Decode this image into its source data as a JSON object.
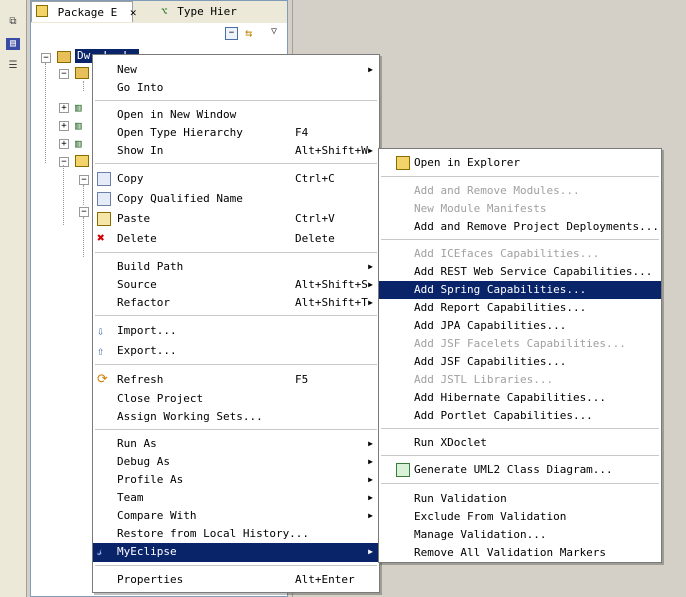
{
  "tabs": [
    {
      "label": "Package E"
    },
    {
      "label": "Type Hier"
    }
  ],
  "tree": {
    "project_label": "Dw. L. L."
  },
  "context_menu": {
    "items": [
      {
        "label": "New",
        "accel": "",
        "submenu": true
      },
      {
        "label": "Go Into",
        "accel": "",
        "submenu": false
      },
      {
        "label": "Open in New Window",
        "accel": "",
        "submenu": false
      },
      {
        "label": "Open Type Hierarchy",
        "accel": "F4",
        "submenu": false
      },
      {
        "label": "Show In",
        "accel": "Alt+Shift+W",
        "submenu": true
      },
      {
        "label": "Copy",
        "accel": "Ctrl+C",
        "submenu": false,
        "icon": "copy-icon"
      },
      {
        "label": "Copy Qualified Name",
        "accel": "",
        "submenu": false,
        "icon": "copy-qualified-icon"
      },
      {
        "label": "Paste",
        "accel": "Ctrl+V",
        "submenu": false,
        "icon": "paste-icon"
      },
      {
        "label": "Delete",
        "accel": "Delete",
        "submenu": false,
        "icon": "delete-icon"
      },
      {
        "label": "Build Path",
        "accel": "",
        "submenu": true
      },
      {
        "label": "Source",
        "accel": "Alt+Shift+S",
        "submenu": true
      },
      {
        "label": "Refactor",
        "accel": "Alt+Shift+T",
        "submenu": true
      },
      {
        "label": "Import...",
        "accel": "",
        "submenu": false,
        "icon": "import-icon"
      },
      {
        "label": "Export...",
        "accel": "",
        "submenu": false,
        "icon": "export-icon"
      },
      {
        "label": "Refresh",
        "accel": "F5",
        "submenu": false,
        "icon": "refresh-icon"
      },
      {
        "label": "Close Project",
        "accel": "",
        "submenu": false
      },
      {
        "label": "Assign Working Sets...",
        "accel": "",
        "submenu": false
      },
      {
        "label": "Run As",
        "accel": "",
        "submenu": true
      },
      {
        "label": "Debug As",
        "accel": "",
        "submenu": true
      },
      {
        "label": "Profile As",
        "accel": "",
        "submenu": true
      },
      {
        "label": "Team",
        "accel": "",
        "submenu": true
      },
      {
        "label": "Compare With",
        "accel": "",
        "submenu": true
      },
      {
        "label": "Restore from Local History...",
        "accel": "",
        "submenu": false
      },
      {
        "label": "MyEclipse",
        "accel": "",
        "submenu": true,
        "icon": "myeclipse-icon",
        "highlighted": true
      },
      {
        "label": "Properties",
        "accel": "Alt+Enter",
        "submenu": false
      }
    ]
  },
  "myeclipse_submenu": {
    "items": [
      {
        "label": "Open in Explorer",
        "enabled": true,
        "icon": "folder-open-icon"
      },
      {
        "label": "Add and Remove Modules...",
        "enabled": false
      },
      {
        "label": "New Module Manifests",
        "enabled": false
      },
      {
        "label": "Add and Remove Project Deployments...",
        "enabled": true
      },
      {
        "label": "Add ICEfaces Capabilities...",
        "enabled": false
      },
      {
        "label": "Add REST Web Service Capabilities...",
        "enabled": true
      },
      {
        "label": "Add Spring Capabilities...",
        "enabled": true,
        "highlighted": true
      },
      {
        "label": "Add Report Capabilities...",
        "enabled": true
      },
      {
        "label": "Add JPA Capabilities...",
        "enabled": true
      },
      {
        "label": "Add JSF Facelets Capabilities...",
        "enabled": false
      },
      {
        "label": "Add JSF Capabilities...",
        "enabled": true
      },
      {
        "label": "Add JSTL Libraries...",
        "enabled": false
      },
      {
        "label": "Add Hibernate Capabilities...",
        "enabled": true
      },
      {
        "label": "Add Portlet Capabilities...",
        "enabled": true
      },
      {
        "label": "Run XDoclet",
        "enabled": true
      },
      {
        "label": "Generate UML2 Class Diagram...",
        "enabled": true,
        "icon": "uml-diagram-icon"
      },
      {
        "label": "Run Validation",
        "enabled": true
      },
      {
        "label": "Exclude From Validation",
        "enabled": true
      },
      {
        "label": "Manage Validation...",
        "enabled": true
      },
      {
        "label": "Remove All Validation Markers",
        "enabled": true
      }
    ]
  },
  "colors": {
    "selection": "#0a246a",
    "menu_bg": "#ffffff",
    "disabled_text": "#a0a0a0",
    "chrome": "#d4d0c8"
  }
}
